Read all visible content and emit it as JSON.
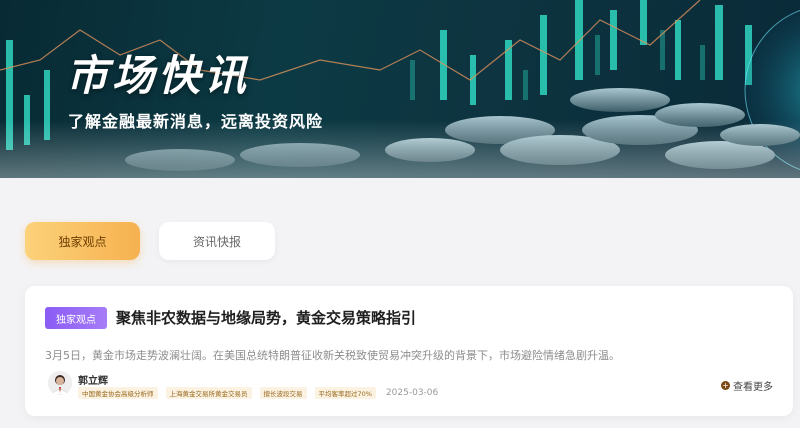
{
  "banner": {
    "title": "市场快讯",
    "subtitle": "了解金融最新消息，远离投资风险"
  },
  "tabs": [
    {
      "label": "独家观点",
      "active": true
    },
    {
      "label": "资讯快报",
      "active": false
    }
  ],
  "article": {
    "tag": "独家观点",
    "title": "聚焦非农数据与地缘局势，黄金交易策略指引",
    "summary": "3月5日，黄金市场走势波澜壮阔。在美国总统特朗普征收新关税致使贸易冲突升级的背景下，市场避险情绪急剧升温。",
    "author": "郭立辉",
    "badges": [
      "中国黄金协会高级分析师",
      "上海黄金交易所黄金交易员",
      "擅长波段交易",
      "平均客率超过70%"
    ],
    "date": "2025-03-06",
    "more_label": "查看更多"
  },
  "colors": {
    "tab_active_start": "#fcd27a",
    "tab_active_end": "#f6b14f",
    "tag_purple": "#8a5cf6",
    "banner_dark": "#0c3a44",
    "accent_teal": "#2fd6c0"
  }
}
